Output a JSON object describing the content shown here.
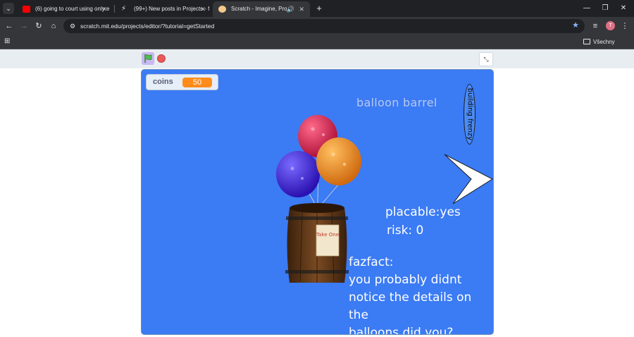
{
  "browser": {
    "tabs": [
      {
        "title": "(6) going to court using only e",
        "favicon_color": "#ff0000",
        "active": false
      },
      {
        "title": "(99+) New posts in Projects - f",
        "favicon_color": "#e8eaed",
        "active": false
      },
      {
        "title": "Scratch - Imagine, Program",
        "favicon_color": "#f4c98a",
        "active": true
      }
    ],
    "url": "scratch.mit.edu/projects/editor/?tutorial=getStarted",
    "profile_initial": "T",
    "bookmarks_folder": "Všechny záložky",
    "accent_color": "#8ab4f8"
  },
  "stage": {
    "background_color": "#3b7bf4",
    "monitor": {
      "label": "coins",
      "value": "50"
    },
    "title": "balloon barrel",
    "badge": "building frenzy",
    "placable": "placable:yes",
    "risk": "risk: 0",
    "fact_heading": "fazfact:",
    "fact_lines": [
      "you probably didnt",
      "notice the details on the",
      "balloons did you?"
    ],
    "barrel_sign": "Take One"
  }
}
